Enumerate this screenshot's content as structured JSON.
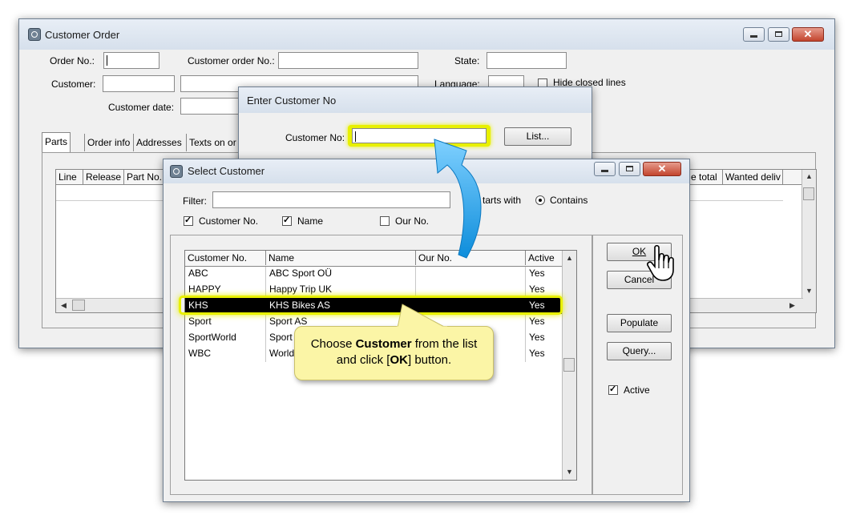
{
  "customer_order": {
    "title": "Customer Order",
    "order_no_label": "Order No.:",
    "customer_order_no_label": "Customer order No.:",
    "state_label": "State:",
    "customer_label": "Customer:",
    "language_label": "Language:",
    "hide_closed_label": "Hide closed lines",
    "customer_date_label": "Customer date:",
    "tabs": [
      "Parts",
      "Order info",
      "Addresses",
      "Texts on or"
    ],
    "columns": [
      "Line",
      "Release",
      "Part No."
    ],
    "right_columns": [
      "e total",
      "Wanted deliv"
    ]
  },
  "enter_customer": {
    "title": "Enter Customer No",
    "customer_no_label": "Customer No:",
    "list_button": "List..."
  },
  "select_customer": {
    "title": "Select Customer",
    "filter_label": "Filter:",
    "starts_with_label": "tarts with",
    "contains_label": "Contains",
    "chk_customer_no": "Customer No.",
    "chk_name": "Name",
    "chk_our_no": "Our No.",
    "columns": [
      "Customer No.",
      "Name",
      "Our No.",
      "Active"
    ],
    "rows": [
      {
        "no": "ABC",
        "name": "ABC Sport OÜ",
        "our": "",
        "active": "Yes"
      },
      {
        "no": "HAPPY",
        "name": "Happy Trip UK",
        "our": "",
        "active": "Yes"
      },
      {
        "no": "KHS",
        "name": "KHS Bikes AS",
        "our": "",
        "active": "Yes"
      },
      {
        "no": "Sport",
        "name": "Sport AS",
        "our": "",
        "active": "Yes"
      },
      {
        "no": "SportWorld",
        "name": "Sport W",
        "our": "",
        "active": "Yes"
      },
      {
        "no": "WBC",
        "name": "World",
        "our": "",
        "active": "Yes"
      }
    ],
    "ok_label": "OK",
    "cancel_label": "Cancel",
    "populate_label": "Populate",
    "query_label": "Query...",
    "active_label": "Active"
  },
  "callout": {
    "text_pre": "Choose ",
    "text_bold": "Customer",
    "text_mid": " from the list and click [",
    "text_bold2": "OK",
    "text_post": "] button."
  },
  "colors": {
    "highlight": "#e8f000",
    "callout_bg": "#fbf5a6",
    "arrow": "#1ea5ec",
    "selected_row": "#000000"
  }
}
